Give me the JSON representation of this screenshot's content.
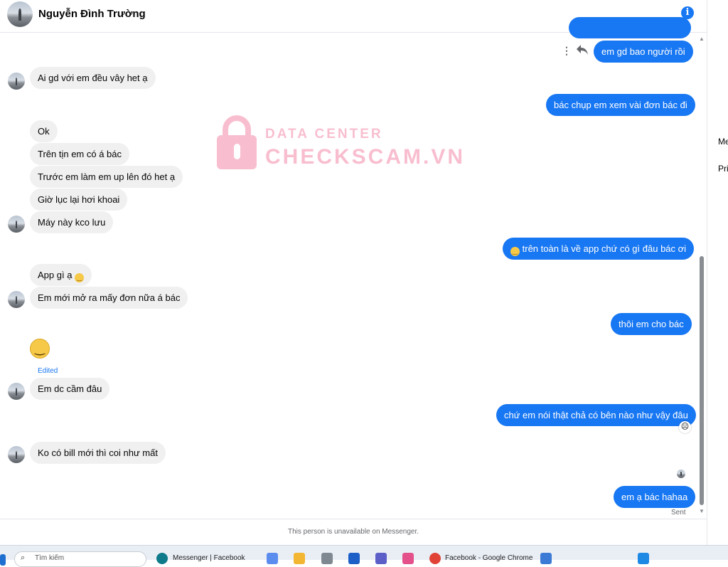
{
  "header": {
    "contact_name": "Nguyễn Đình Trường",
    "info_icon": "info-icon"
  },
  "messages": {
    "partial_top": "",
    "m1": "em gd bao người rồi",
    "m2": "Ai gd với em đều vây het ạ",
    "m3": "bác chụp em xem vài đơn bác đi",
    "m4": "Ok",
    "m5": "Trên tịn em có á bác",
    "m6": "Trước em làm em up lên đó het ạ",
    "m7": "Giờ lục lại hơi khoai",
    "m8": "Máy này kco lưu",
    "m9": "trên toàn là về app chứ có gì đâu bác ơi",
    "m10": "App gì ạ",
    "m11": "Em mới mở ra mấy đơn nữa á bác",
    "m12": "thôi em cho bác",
    "m13_edited": "Edited",
    "m14": "Em dc cầm đâu",
    "m15": "chứ em nói thật chả có bên nào như vậy đâu",
    "m16": "Ko có bill mới thì coi như mất",
    "m17": "em ạ bác hahaa",
    "sent_status": "Sent"
  },
  "watermark": {
    "line1": "DATA CENTER",
    "line2": "CHECKSCAM.VN"
  },
  "right_panel": {
    "item1": "Me",
    "item2": "Pri"
  },
  "footer": {
    "notice": "This person is unavailable on Messenger."
  },
  "taskbar": {
    "search_placeholder": "Tìm kiếm",
    "app1": "Messenger | Facebook",
    "app2": "Facebook - Google Chrome"
  },
  "colors": {
    "outgoing_bubble": "#1877f2",
    "incoming_bubble": "#f0f0f0",
    "watermark": "#f48aa8"
  }
}
